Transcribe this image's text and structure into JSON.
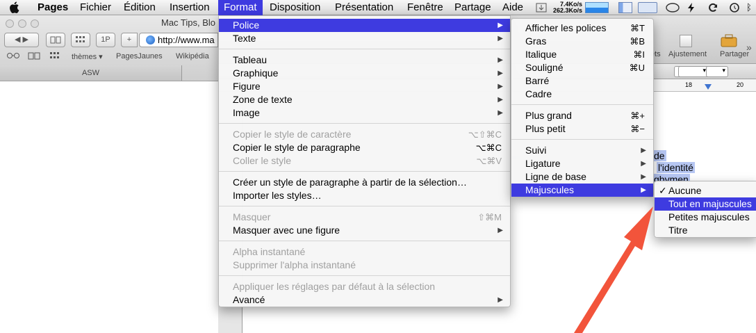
{
  "menubar": {
    "app": "Pages",
    "items": [
      "Fichier",
      "Édition",
      "Insertion",
      "Format",
      "Disposition",
      "Présentation",
      "Fenêtre",
      "Partage",
      "Aide"
    ],
    "net_up": "7.4Ko/s",
    "net_down": "262.3Ko/s"
  },
  "safari": {
    "title": "Mac Tips, Blo",
    "url": "http://www.ma",
    "bookmarks": [
      "thèmes ▾",
      "PagesJaunes",
      "Wikipédia"
    ],
    "tab": "ASW",
    "onepass": "1P"
  },
  "pages_toolbar": {
    "ajustement": "Ajustement",
    "partager": "Partager",
    "cut_label": "ets",
    "ruler_marks": [
      "18",
      "20"
    ]
  },
  "doc_text": {
    "line1_end": "de",
    "line2_end": "l'identité",
    "line3_end": "gbymen"
  },
  "format_menu": {
    "items": [
      {
        "label": "Police",
        "arrow": true,
        "highlight": true
      },
      {
        "label": "Texte",
        "arrow": true
      },
      {
        "sep": true
      },
      {
        "label": "Tableau",
        "arrow": true
      },
      {
        "label": "Graphique",
        "arrow": true
      },
      {
        "label": "Figure",
        "arrow": true
      },
      {
        "label": "Zone de texte",
        "arrow": true
      },
      {
        "label": "Image",
        "arrow": true
      },
      {
        "sep": true
      },
      {
        "label": "Copier le style de caractère",
        "shortcut": "⌥⇧⌘C",
        "disabled": true
      },
      {
        "label": "Copier le style de paragraphe",
        "shortcut": "⌥⌘C"
      },
      {
        "label": "Coller le style",
        "shortcut": "⌥⌘V",
        "disabled": true
      },
      {
        "sep": true
      },
      {
        "label": "Créer un style de paragraphe à partir de la sélection…"
      },
      {
        "label": "Importer les styles…"
      },
      {
        "sep": true
      },
      {
        "label": "Masquer",
        "shortcut": "⇧⌘M",
        "disabled": true
      },
      {
        "label": "Masquer avec une figure",
        "arrow": true
      },
      {
        "sep": true
      },
      {
        "label": "Alpha instantané",
        "disabled": true
      },
      {
        "label": "Supprimer l'alpha instantané",
        "disabled": true
      },
      {
        "sep": true
      },
      {
        "label": "Appliquer les réglages par défaut à la sélection",
        "disabled": true
      },
      {
        "label": "Avancé",
        "arrow": true
      }
    ]
  },
  "police_menu": {
    "items": [
      {
        "label": "Afficher les polices",
        "shortcut": "⌘T"
      },
      {
        "label": "Gras",
        "shortcut": "⌘B"
      },
      {
        "label": "Italique",
        "shortcut": "⌘I"
      },
      {
        "label": "Souligné",
        "shortcut": "⌘U"
      },
      {
        "label": "Barré"
      },
      {
        "label": "Cadre"
      },
      {
        "sep": true
      },
      {
        "label": "Plus grand",
        "shortcut": "⌘+"
      },
      {
        "label": "Plus petit",
        "shortcut": "⌘−"
      },
      {
        "sep": true
      },
      {
        "label": "Suivi",
        "arrow": true
      },
      {
        "label": "Ligature",
        "arrow": true
      },
      {
        "label": "Ligne de base",
        "arrow": true
      },
      {
        "label": "Majuscules",
        "arrow": true,
        "highlight": true
      }
    ]
  },
  "majuscules_menu": {
    "items": [
      {
        "label": "Aucune",
        "checked": true
      },
      {
        "label": "Tout en majuscules",
        "highlight": true
      },
      {
        "label": "Petites majuscules"
      },
      {
        "label": "Titre"
      }
    ]
  },
  "colors": {
    "accent": "#3e3be0",
    "arrow": "#f2543b",
    "highlight_text": "#b6c6f2"
  }
}
